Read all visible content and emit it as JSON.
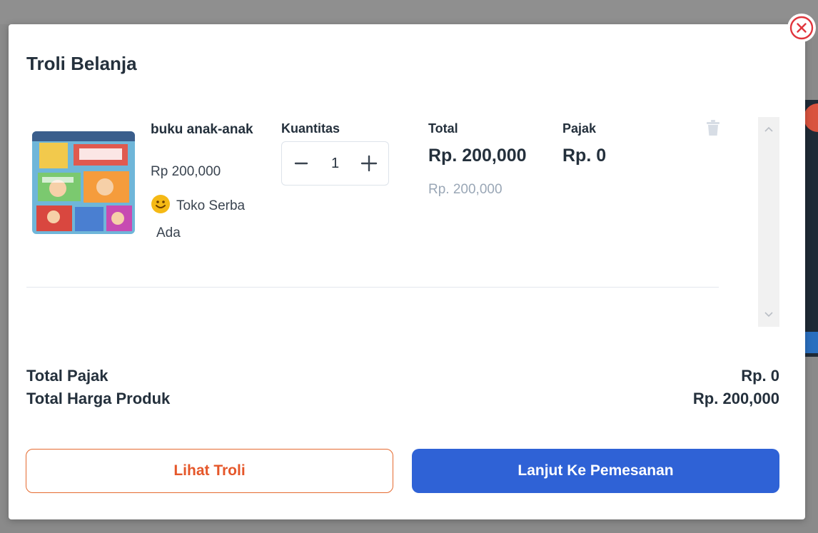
{
  "modal": {
    "title": "Troli Belanja"
  },
  "cart_item": {
    "name": "buku anak-anak",
    "price": "Rp 200,000",
    "store_name_line1": "Toko Serba",
    "store_name_line2": "Ada",
    "quantity_label": "Kuantitas",
    "quantity": "1",
    "total_label": "Total",
    "total_value": "Rp. 200,000",
    "total_original": "Rp. 200,000",
    "tax_label": "Pajak",
    "tax_value": "Rp. 0"
  },
  "summary": {
    "tax_label": "Total Pajak",
    "tax_value": "Rp. 0",
    "total_label": "Total Harga Produk",
    "total_value": "Rp. 200,000"
  },
  "buttons": {
    "view_cart": "Lihat Troli",
    "checkout": "Lanjut Ke Pemesanan"
  },
  "icons": {
    "close": "close-circle-icon",
    "trash": "trash-icon",
    "minus": "minus-icon",
    "plus": "plus-icon",
    "store": "smiley-store-icon",
    "scroll_up": "chevron-up-icon",
    "scroll_down": "chevron-down-icon"
  },
  "colors": {
    "primary": "#2f62d6",
    "accent_orange": "#e5572a",
    "close_red": "#e0353d",
    "text_dark": "#24303c",
    "muted": "#9aa7b6"
  }
}
